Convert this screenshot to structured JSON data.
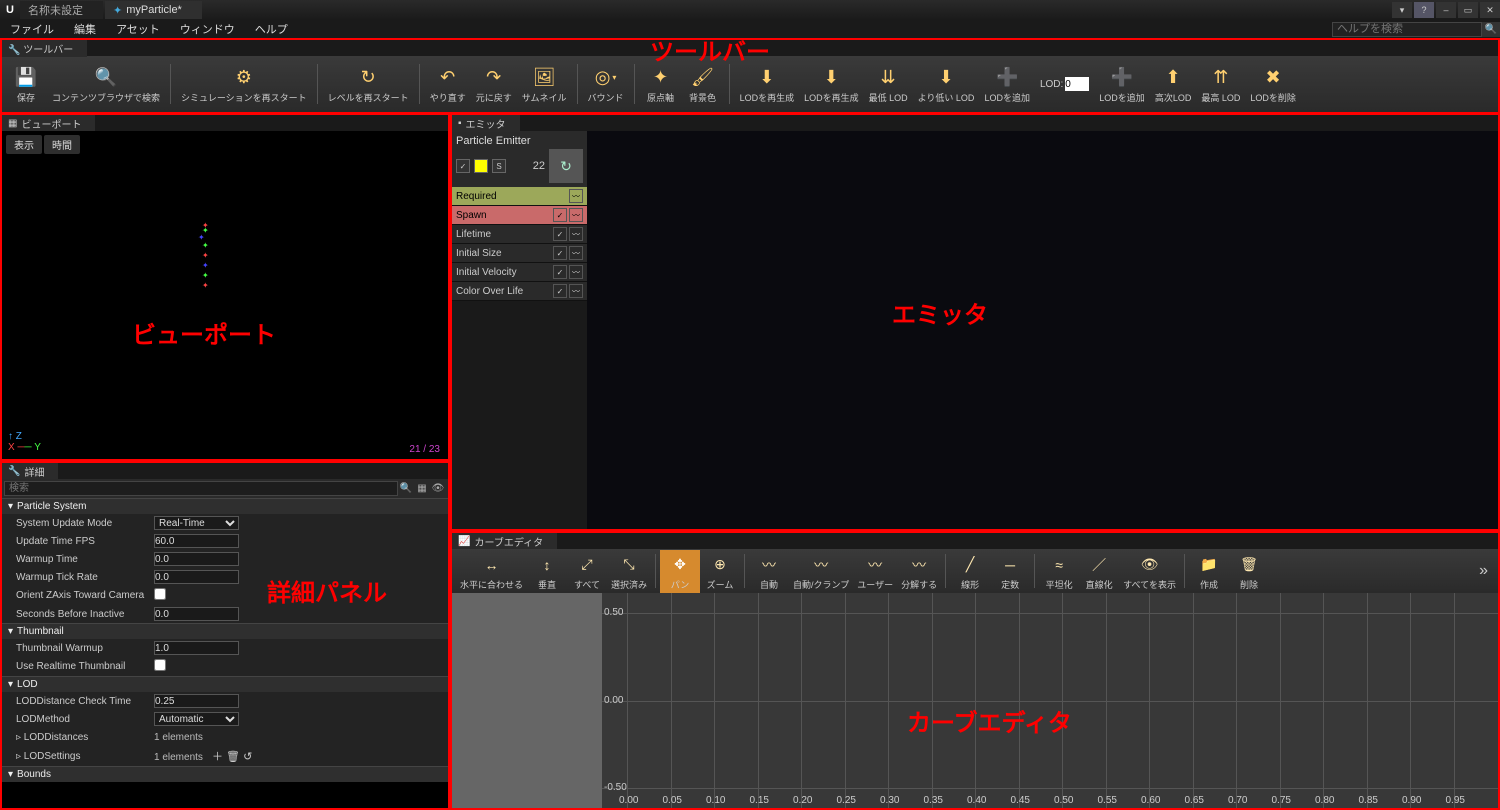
{
  "titlebar": {
    "tabs": [
      {
        "label": "名称未設定",
        "active": false
      },
      {
        "label": "myParticle*",
        "active": true
      }
    ]
  },
  "menubar": {
    "items": [
      "ファイル",
      "編集",
      "アセット",
      "ウィンドウ",
      "ヘルプ"
    ],
    "search_placeholder": "ヘルプを検索"
  },
  "toolbar_tab": "ツールバー",
  "toolbar": [
    {
      "icon": "💾",
      "label": "保存",
      "name": "save-button"
    },
    {
      "icon": "🔍",
      "label": "コンテンツブラウザで検索",
      "name": "find-in-cb-button"
    },
    {
      "sep": true
    },
    {
      "icon": "⚙",
      "label": "シミュレーションを再スタート",
      "name": "restart-sim-button"
    },
    {
      "sep": true
    },
    {
      "icon": "↻",
      "label": "レベルを再スタート",
      "name": "restart-level-button"
    },
    {
      "sep": true
    },
    {
      "icon": "↶",
      "label": "やり直す",
      "name": "redo-button"
    },
    {
      "icon": "↷",
      "label": "元に戻す",
      "name": "undo-button"
    },
    {
      "icon": "🖼",
      "label": "サムネイル",
      "name": "thumbnail-button"
    },
    {
      "sep": true
    },
    {
      "icon": "◎",
      "label": "バウンド",
      "name": "bounds-button",
      "dropdown": true
    },
    {
      "sep": true
    },
    {
      "icon": "✦",
      "label": "原点軸",
      "name": "origin-axis-button"
    },
    {
      "icon": "🖌",
      "label": "背景色",
      "name": "bgcolor-button"
    },
    {
      "sep": true
    },
    {
      "icon": "⬇",
      "label": "LODを再生成",
      "name": "lod-regen-button"
    },
    {
      "icon": "⬇",
      "label": "LODを再生成",
      "name": "lod-regen2-button"
    },
    {
      "icon": "⇊",
      "label": "最低 LOD",
      "name": "lowest-lod-button"
    },
    {
      "icon": "⬇",
      "label": "より低い LOD",
      "name": "lower-lod-button"
    },
    {
      "icon": "➕",
      "label": "LODを追加",
      "name": "add-lod-button"
    },
    {
      "lod_field": true,
      "label": "LOD:",
      "value": "0"
    },
    {
      "icon": "➕",
      "label": "LODを追加",
      "name": "add-lod2-button"
    },
    {
      "icon": "⬆",
      "label": "高次LOD",
      "name": "higher-lod-button"
    },
    {
      "icon": "⇈",
      "label": "最高 LOD",
      "name": "highest-lod-button"
    },
    {
      "icon": "✖",
      "label": "LODを削除",
      "name": "delete-lod-button"
    }
  ],
  "annotations": {
    "toolbar": "ツールバー",
    "viewport": "ビューポート",
    "emitter": "エミッタ",
    "details": "詳細パネル",
    "curve": "カーブエディタ"
  },
  "viewport": {
    "tab": "ビューポート",
    "btn_display": "表示",
    "btn_time": "時間",
    "fps": "21 / 23"
  },
  "details": {
    "tab": "詳細",
    "search_placeholder": "検索",
    "sections": [
      {
        "title": "Particle System",
        "props": [
          {
            "label": "System Update Mode",
            "type": "select",
            "value": "Real-Time"
          },
          {
            "label": "Update Time FPS",
            "type": "text",
            "value": "60.0"
          },
          {
            "label": "Warmup Time",
            "type": "text",
            "value": "0.0"
          },
          {
            "label": "Warmup Tick Rate",
            "type": "text",
            "value": "0.0"
          },
          {
            "label": "Orient ZAxis Toward Camera",
            "type": "check",
            "value": false
          },
          {
            "label": "Seconds Before Inactive",
            "type": "text",
            "value": "0.0"
          }
        ]
      },
      {
        "title": "Thumbnail",
        "props": [
          {
            "label": "Thumbnail Warmup",
            "type": "text",
            "value": "1.0"
          },
          {
            "label": "Use Realtime Thumbnail",
            "type": "check",
            "value": false
          }
        ]
      },
      {
        "title": "LOD",
        "props": [
          {
            "label": "LODDistance Check Time",
            "type": "text",
            "value": "0.25"
          },
          {
            "label": "LODMethod",
            "type": "select",
            "value": "Automatic"
          },
          {
            "label": "LODDistances",
            "type": "array",
            "value": "1 elements"
          },
          {
            "label": "LODSettings",
            "type": "array_edit",
            "value": "1 elements"
          }
        ]
      },
      {
        "title": "Bounds",
        "props": []
      }
    ]
  },
  "emitter": {
    "tab": "エミッタ",
    "name": "Particle Emitter",
    "count": "22",
    "modules": [
      {
        "label": "Required",
        "kind": "req"
      },
      {
        "label": "Spawn",
        "kind": "spawn",
        "checked": true
      },
      {
        "label": "Lifetime",
        "kind": "norm",
        "checked": true
      },
      {
        "label": "Initial Size",
        "kind": "norm",
        "checked": true
      },
      {
        "label": "Initial Velocity",
        "kind": "norm",
        "checked": true
      },
      {
        "label": "Color Over Life",
        "kind": "norm",
        "checked": true
      }
    ]
  },
  "curve": {
    "tab": "カーブエディタ",
    "toolbar": [
      {
        "icon": "↔",
        "label": "水平に合わせる",
        "name": "fit-horizontal-button"
      },
      {
        "icon": "↕",
        "label": "垂直",
        "name": "fit-vertical-button"
      },
      {
        "icon": "⤢",
        "label": "すべて",
        "name": "fit-all-button"
      },
      {
        "icon": "⤡",
        "label": "選択済み",
        "name": "fit-selected-button"
      },
      {
        "sep": true
      },
      {
        "icon": "✥",
        "label": "パン",
        "name": "pan-button",
        "active": true
      },
      {
        "icon": "⊕",
        "label": "ズーム",
        "name": "zoom-button"
      },
      {
        "sep": true
      },
      {
        "icon": "〰",
        "label": "自動",
        "name": "auto-button"
      },
      {
        "icon": "〰",
        "label": "自動/クランプ",
        "name": "auto-clamp-button"
      },
      {
        "icon": "〰",
        "label": "ユーザー",
        "name": "user-button"
      },
      {
        "icon": "〰",
        "label": "分解する",
        "name": "break-button"
      },
      {
        "sep": true
      },
      {
        "icon": "╱",
        "label": "線形",
        "name": "linear-button"
      },
      {
        "icon": "─",
        "label": "定数",
        "name": "constant-button"
      },
      {
        "sep": true
      },
      {
        "icon": "≈",
        "label": "平坦化",
        "name": "flatten-button"
      },
      {
        "icon": "／",
        "label": "直線化",
        "name": "straighten-button"
      },
      {
        "icon": "👁",
        "label": "すべてを表示",
        "name": "show-all-button"
      },
      {
        "sep": true
      },
      {
        "icon": "📁",
        "label": "作成",
        "name": "create-tab-button"
      },
      {
        "icon": "🗑",
        "label": "削除",
        "name": "delete-tab-button"
      }
    ],
    "ylabels": [
      "0.50",
      "0.00",
      "-0.50"
    ],
    "xlabels": [
      "0.00",
      "0.05",
      "0.10",
      "0.15",
      "0.20",
      "0.25",
      "0.30",
      "0.35",
      "0.40",
      "0.45",
      "0.50",
      "0.55",
      "0.60",
      "0.65",
      "0.70",
      "0.75",
      "0.80",
      "0.85",
      "0.90",
      "0.95"
    ]
  }
}
